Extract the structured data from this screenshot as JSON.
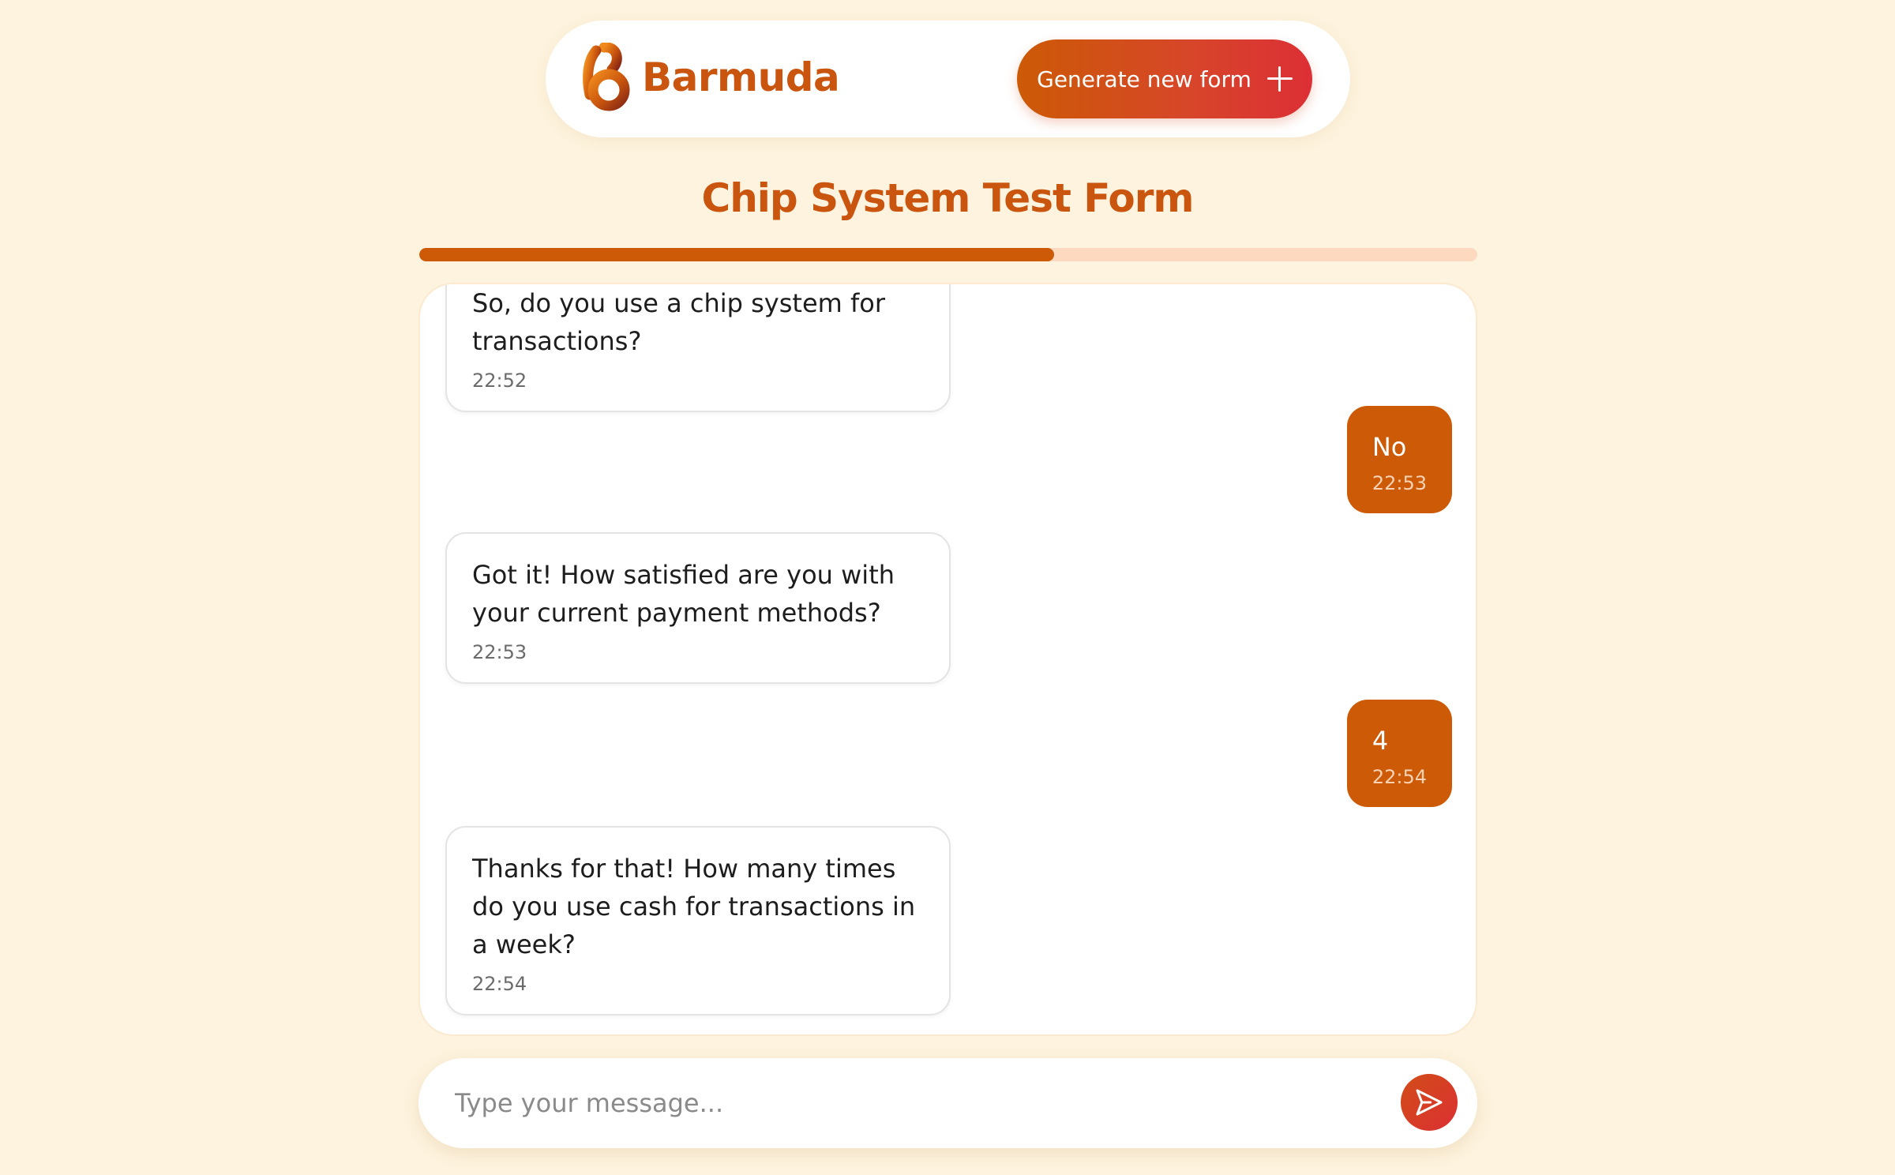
{
  "brand": {
    "name": "Barmuda",
    "colors": {
      "primary": "#c9550e",
      "accent_red": "#dc2f36",
      "background": "#fdf3de"
    }
  },
  "header": {
    "generate_label": "Generate new form",
    "generate_icon": "plus-icon"
  },
  "form": {
    "title": "Chip System Test Form",
    "progress_fraction": 0.6
  },
  "messages": [
    {
      "role": "bot",
      "text": "So, do you use a chip system for transactions?",
      "time": "22:52"
    },
    {
      "role": "user",
      "text": "No",
      "time": "22:53"
    },
    {
      "role": "bot",
      "text": "Got it! How satisfied are you with your current payment methods?",
      "time": "22:53"
    },
    {
      "role": "user",
      "text": "4",
      "time": "22:54"
    },
    {
      "role": "bot",
      "text": "Thanks for that! How many times do you use cash for transactions in a week?",
      "time": "22:54"
    }
  ],
  "composer": {
    "placeholder": "Type your message...",
    "send_icon": "send-icon"
  }
}
